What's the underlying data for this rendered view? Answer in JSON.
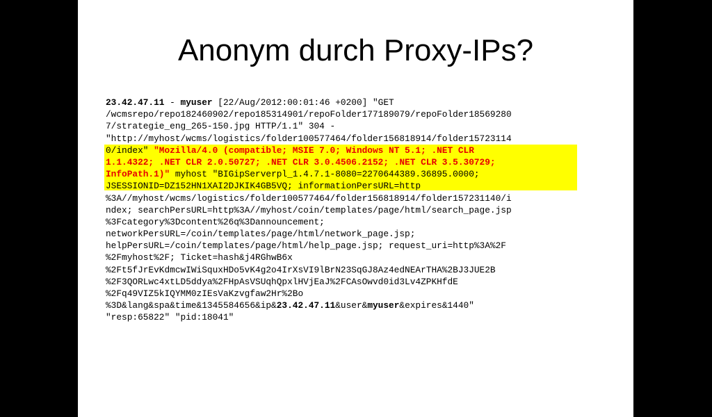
{
  "slide": {
    "title": "Anonym durch Proxy-IPs?"
  },
  "log": {
    "l1_ip": "23.42.47.11",
    "l1_sep": " - ",
    "l1_user": "myuser",
    "l1_rest": " [22/Aug/2012:00:01:46 +0200] \"GET",
    "l2": "/wcmsrepo/repo182460902/repo185314901/repoFolder177189079/repoFolder18569280",
    "l3": "7/strategie_eng_265-150.jpg HTTP/1.1\" 304 -",
    "l4": "\"http://myhost/wcms/logistics/folder100577464/folder156818914/folder15723114",
    "l5_a": "0/index\" ",
    "l5_red": "\"Mozilla/4.0 (compatible; MSIE 7.0; Windows NT 5.1; .NET CLR",
    "l6_red": "1.1.4322; .NET CLR 2.0.50727; .NET CLR 3.0.4506.2152; .NET CLR 3.5.30729;",
    "l7_red": "InfoPath.1)\"",
    "l7_rest": " myhost \"BIGipServerpl_1.4.7.1-8080=2270644389.36895.0000;",
    "l8": "JSESSIONID=DZ152HN1XAI2DJKIK4GB5VQ; informationPersURL=http",
    "l9": "%3A//myhost/wcms/logistics/folder100577464/folder156818914/folder157231140/i",
    "l10": "ndex; searchPersURL=http%3A//myhost/coin/templates/page/html/search_page.jsp",
    "l11": "%3Fcategory%3Dcontent%26q%3Dannouncement;",
    "l12": "networkPersURL=/coin/templates/page/html/network_page.jsp;",
    "l13": "helpPersURL=/coin/templates/page/html/help_page.jsp; request_uri=http%3A%2F",
    "l14": "%2Fmyhost%2F; Ticket=hash&j4RGhwB6x",
    "l15": "%2Ft5fJrEvKdmcwIWiSquxHDo5vK4g2o4IrXsVI9lBrN23SqGJ8Az4edNEArTHA%2BJ3JUE2B",
    "l16": "%2F3QORLwc4xtLD5ddya%2FHpAsVSUqhQpxlHVjEaJ%2FCAsOwvd0id3Lv4ZPKHfdE",
    "l17": "%2Fq49VIZ5kIQYMM0zIEsVaKzvgfaw2Hr%2Bo",
    "l18_a": "%3D&lang&spa&time&1345584656&ip&",
    "l18_ip": "23.42.47.11",
    "l18_b": "&user&",
    "l18_user": "myuser",
    "l18_c": "&expires&1440\"",
    "l19": "\"resp:65822\" \"pid:18041\""
  }
}
